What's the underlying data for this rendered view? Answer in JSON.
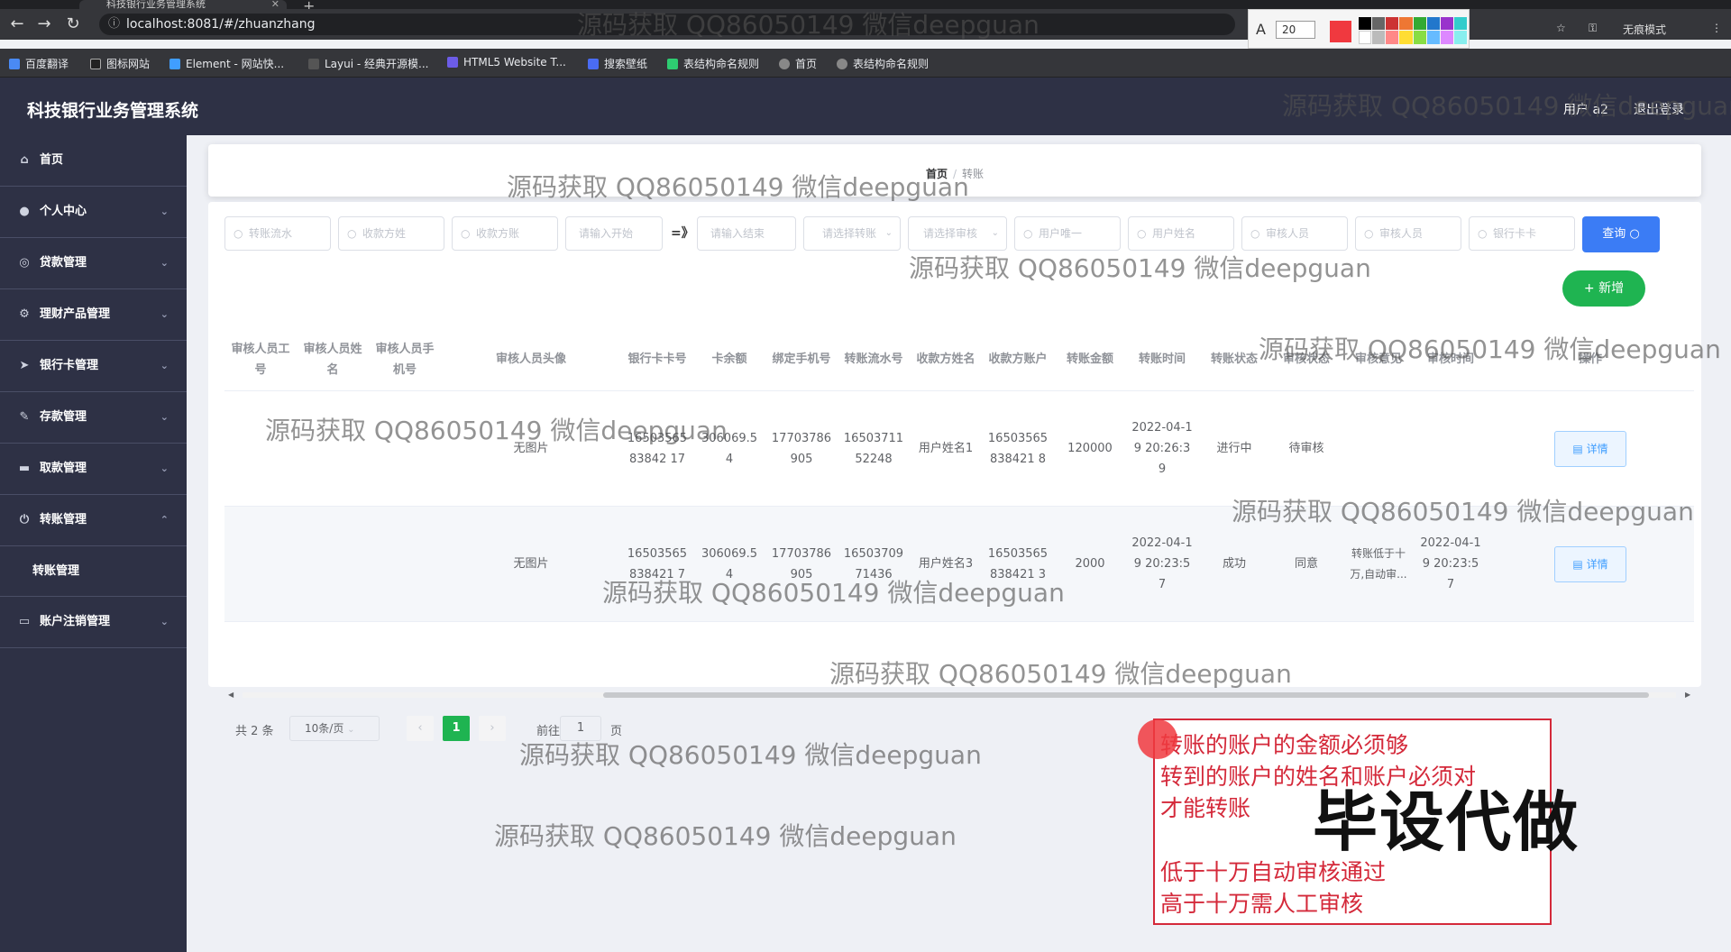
{
  "browser": {
    "tab_title": "科技银行业务管理系统",
    "url": "localhost:8081/#/zhuanzhang",
    "incognito_label": "无痕模式",
    "bookmarks": [
      "百度翻译",
      "图标网站",
      "Element - 网站快...",
      "Layui - 经典开源模...",
      "HTML5 Website T...",
      "搜索壁纸",
      "表结构命名规则",
      "首页",
      "表结构命名规则"
    ],
    "annot_font_size": "20"
  },
  "header": {
    "title": "科技银行业务管理系统",
    "user": "用户 a2",
    "logout": "退出登录"
  },
  "sidebar": {
    "items": [
      {
        "label": "首页"
      },
      {
        "label": "个人中心"
      },
      {
        "label": "贷款管理"
      },
      {
        "label": "理财产品管理"
      },
      {
        "label": "银行卡管理"
      },
      {
        "label": "存款管理"
      },
      {
        "label": "取款管理"
      },
      {
        "label": "转账管理"
      },
      {
        "label": "转账管理"
      },
      {
        "label": "账户注销管理"
      }
    ]
  },
  "breadcrumb": {
    "home": "首页",
    "sep": "/",
    "current": "转账"
  },
  "search": {
    "placeholders": [
      "转账流水",
      "收款方姓",
      "收款方账",
      "请输入开始",
      "请输入结束",
      "请选择转账",
      "请选择审核",
      "用户唯一",
      "用户姓名",
      "审核人员",
      "审核人员",
      "银行卡卡"
    ],
    "range_arrow": "=》",
    "query_label": "查询",
    "add_label": "新增"
  },
  "table": {
    "headers": [
      "审核人员工号",
      "审核人员姓名",
      "审核人员手机号",
      "审核人员头像",
      "银行卡卡号",
      "卡余额",
      "绑定手机号",
      "转账流水号",
      "收款方姓名",
      "收款方账户",
      "转账金额",
      "转账时间",
      "转账状态",
      "审核状态",
      "审核意见",
      "审核时间",
      "操作"
    ],
    "rows": [
      [
        "",
        "",
        "",
        "无图片",
        "1650356583842 17",
        "306069.54",
        "17703786905",
        "1650371152248",
        "用户姓名1",
        "16503565838421 8",
        "120000",
        "2022-04-19 20:26:39",
        "进行中",
        "待审核",
        "",
        "",
        "详情"
      ],
      [
        "",
        "",
        "",
        "无图片",
        "16503565838421 7",
        "306069.54",
        "17703786905",
        "1650370971436",
        "用户姓名3",
        "16503565838421 3",
        "2000",
        "2022-04-19 20:23:57",
        "成功",
        "同意",
        "转账低于十万,自动审...",
        "2022-04-19 20:23:57",
        "详情"
      ]
    ]
  },
  "pagination": {
    "total": "共 2 条",
    "page_size": "10条/页",
    "current": "1",
    "goto": "前往",
    "goto_value": "1",
    "page_unit": "页"
  },
  "watermark": "源码获取 QQ86050149 微信deepguan",
  "note": {
    "lines": [
      "转账的账户的金额必须够",
      "转到的账户的姓名和账户必须对",
      "才能转账",
      "低于十万自动审核通过",
      "高于十万需人工审核"
    ],
    "big": "毕设代做"
  },
  "colors": {
    "sidebar": "#2e3145",
    "primary": "#3b7cf5",
    "success": "#1fb451",
    "note_red": "#d4293a"
  }
}
